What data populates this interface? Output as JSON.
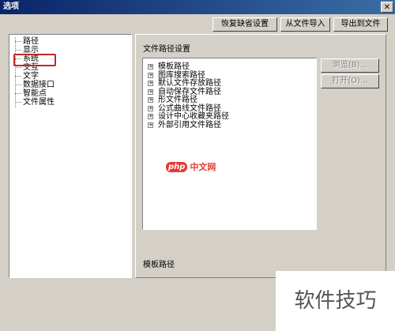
{
  "window": {
    "title": "选项",
    "close_glyph": "✕"
  },
  "top_buttons": {
    "restore_defaults": "恢复缺省设置",
    "import": "从文件导入",
    "export": "导出到文件"
  },
  "left_tree": {
    "items": [
      "路径",
      "显示",
      "系统",
      "交互",
      "文字",
      "数据接口",
      "智能点",
      "文件属性"
    ],
    "highlighted": "系统"
  },
  "main": {
    "group_label": "文件路径设置",
    "tree_items": [
      "模板路径",
      "图库搜索路径",
      "默认文件存放路径",
      "自动保存文件路径",
      "形文件路径",
      "公式曲线文件路径",
      "设计中心收藏夹路径",
      "外部引用文件路径"
    ],
    "side_buttons": {
      "browse": "浏览(B)...",
      "open": "打开(O)..."
    },
    "description_label": "模板路径"
  },
  "overlays": {
    "php_logo": "php",
    "php_site": "中文网",
    "watermark": "软件技巧"
  },
  "colors": {
    "highlight_box": "#c0282d",
    "php_red": "#e8392f",
    "title_bar": "#0a246a"
  }
}
